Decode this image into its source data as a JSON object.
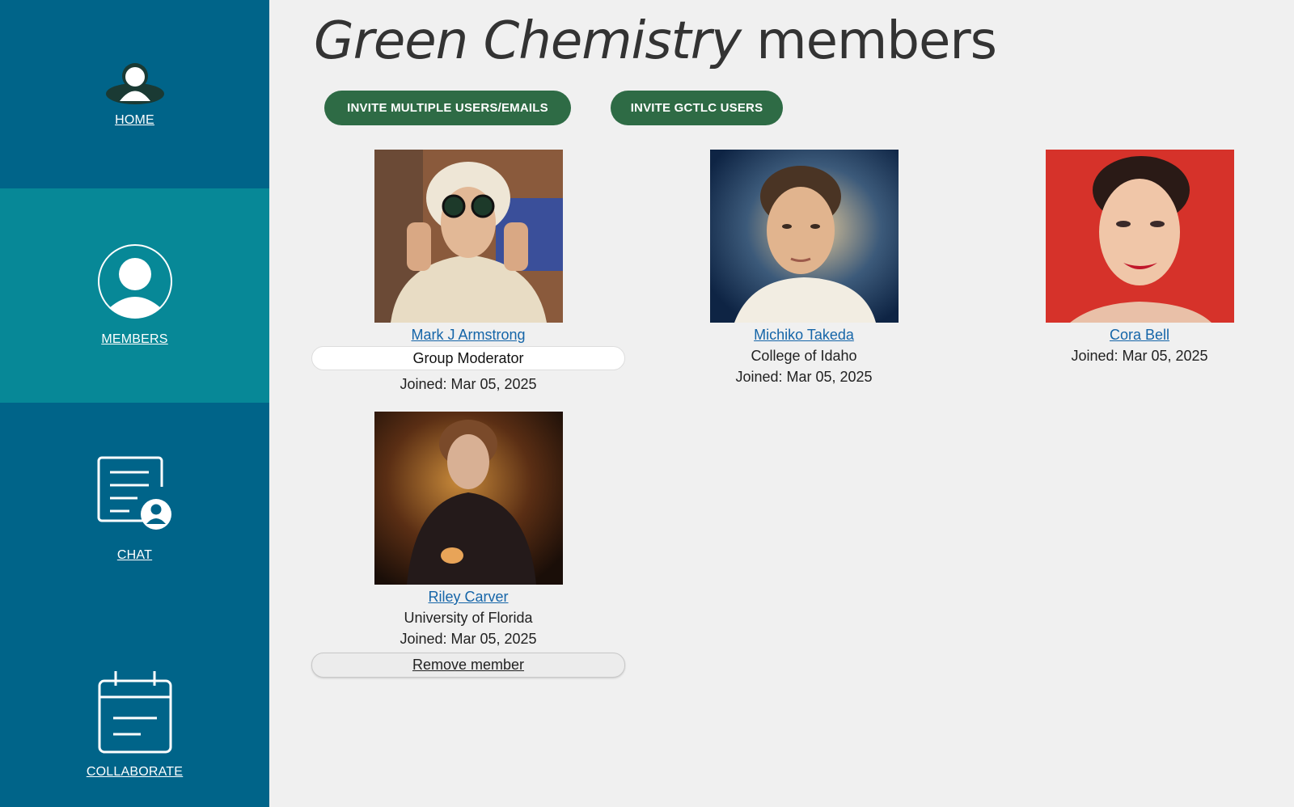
{
  "sidebar": {
    "items": [
      {
        "label": "HOME",
        "icon": "home-user-icon",
        "active": false
      },
      {
        "label": "MEMBERS",
        "icon": "member-user-icon",
        "active": true
      },
      {
        "label": "CHAT",
        "icon": "chat-document-icon",
        "active": false
      },
      {
        "label": "COLLABORATE",
        "icon": "calendar-icon",
        "active": false
      }
    ],
    "colors": {
      "background": "#006489",
      "active": "#078897"
    }
  },
  "page": {
    "title_em": "Green Chemistry",
    "title_rest": " members"
  },
  "actions": {
    "invite_multiple_label": "INVITE MULTIPLE USERS/EMAILS",
    "invite_gctlc_label": "INVITE GCTLC USERS",
    "button_color": "#2e6b45"
  },
  "members": [
    {
      "name": "Mark J Armstrong",
      "role": "Group Moderator",
      "joined": "Joined: Mar 05, 2025",
      "photo": "member-photo-goggles"
    },
    {
      "name": "Michiko Takeda",
      "affiliation": "College of Idaho",
      "joined": "Joined: Mar 05, 2025",
      "photo": "member-photo-portrait"
    },
    {
      "name": "Cora Bell",
      "joined": "Joined: Mar 05, 2025",
      "photo": "member-photo-red-background"
    },
    {
      "name": "Riley Carver",
      "affiliation": "University of Florida",
      "joined": "Joined: Mar 05, 2025",
      "remove_label": "Remove member",
      "photo": "member-photo-dark-portrait"
    }
  ]
}
